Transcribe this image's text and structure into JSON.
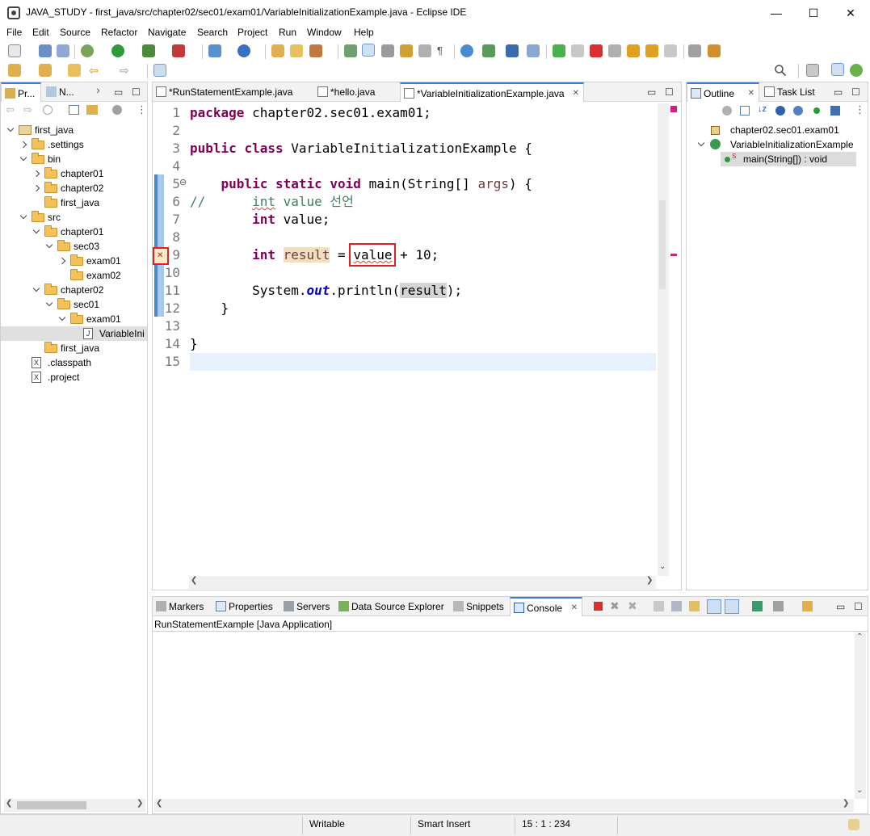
{
  "window": {
    "title": "JAVA_STUDY - first_java/src/chapter02/sec01/exam01/VariableInitializationExample.java - Eclipse IDE",
    "minimize": "—",
    "maximize": "☐",
    "close": "✕"
  },
  "menu": [
    "File",
    "Edit",
    "Source",
    "Refactor",
    "Navigate",
    "Search",
    "Project",
    "Run",
    "Window",
    "Help"
  ],
  "explorer": {
    "tabs": [
      "Pr...",
      "N..."
    ],
    "tree": [
      {
        "label": "first_java",
        "kind": "project",
        "state": "open",
        "level": 0
      },
      {
        "label": ".settings",
        "kind": "folder",
        "state": "closed",
        "level": 1
      },
      {
        "label": "bin",
        "kind": "folder",
        "state": "open",
        "level": 1
      },
      {
        "label": "chapter01",
        "kind": "folder",
        "state": "closed",
        "level": 2
      },
      {
        "label": "chapter02",
        "kind": "folder",
        "state": "closed",
        "level": 2
      },
      {
        "label": "first_java",
        "kind": "folder",
        "state": "none",
        "level": 2
      },
      {
        "label": "src",
        "kind": "folder",
        "state": "open",
        "level": 1
      },
      {
        "label": "chapter01",
        "kind": "folder",
        "state": "open",
        "level": 2
      },
      {
        "label": "sec03",
        "kind": "folder",
        "state": "open",
        "level": 3
      },
      {
        "label": "exam01",
        "kind": "folder",
        "state": "closed",
        "level": 4
      },
      {
        "label": "exam02",
        "kind": "folder",
        "state": "none",
        "level": 4
      },
      {
        "label": "chapter02",
        "kind": "folder",
        "state": "open",
        "level": 2
      },
      {
        "label": "sec01",
        "kind": "folder",
        "state": "open",
        "level": 3
      },
      {
        "label": "exam01",
        "kind": "folder",
        "state": "open",
        "level": 4
      },
      {
        "label": "VariableIni",
        "kind": "java",
        "state": "none",
        "level": 5,
        "selected": true
      },
      {
        "label": "first_java",
        "kind": "folder",
        "state": "none",
        "level": 2
      },
      {
        "label": ".classpath",
        "kind": "xfile",
        "state": "none",
        "level": 1
      },
      {
        "label": ".project",
        "kind": "xfile",
        "state": "none",
        "level": 1
      }
    ]
  },
  "editor": {
    "tabs": [
      {
        "label": "*RunStatementExample.java",
        "active": false
      },
      {
        "label": "*hello.java",
        "active": false
      },
      {
        "label": "*VariableInitializationExample.java",
        "active": true
      }
    ],
    "line_numbers": [
      "1",
      "2",
      "3",
      "4",
      "5",
      "6",
      "7",
      "8",
      "9",
      "10",
      "11",
      "12",
      "13",
      "14",
      "15"
    ],
    "code": {
      "l1_kw": "package",
      "l1_rest": " chapter02.sec01.exam01;",
      "l3_kw1": "public",
      "l3_kw2": "class",
      "l3_rest": " VariableInitializationExample {",
      "l5_indent": "    ",
      "l5_kw1": "public",
      "l5_kw2": "static",
      "l5_kw3": "void",
      "l5_rest": " main(String[] ",
      "l5_args": "args",
      "l5_end": ") {",
      "l6_comment": "//      ",
      "l6_int": "int",
      "l6_rest": " value 선언",
      "l7_indent": "        ",
      "l7_kw": "int",
      "l7_rest": " value;",
      "l9_indent": "        ",
      "l9_kw": "int",
      "l9_result": "result",
      "l9_eq": " = ",
      "l9_value": "value",
      "l9_rest": " + 10;",
      "l11_indent": "        ",
      "l11_sys": "System.",
      "l11_out": "out",
      "l11_print": ".println(",
      "l11_result": "result",
      "l11_end": ");",
      "l12": "    }",
      "l14": "}"
    },
    "fold_marker": "⊖"
  },
  "outline": {
    "tabs": [
      "Outline",
      "Task List"
    ],
    "items": [
      {
        "label": "chapter02.sec01.exam01",
        "level": 0
      },
      {
        "label": "VariableInitializationExample",
        "level": 0
      },
      {
        "label": "main(String[]) : void",
        "level": 1
      }
    ],
    "static_marker": "S"
  },
  "bottom": {
    "tabs": [
      "Markers",
      "Properties",
      "Servers",
      "Data Source Explorer",
      "Snippets",
      "Console"
    ],
    "console_title": "RunStatementExample [Java Application]"
  },
  "status": {
    "writable": "Writable",
    "insert": "Smart Insert",
    "position": "15 : 1 : 234"
  },
  "colors": {
    "keyword": "#7f0055",
    "comment": "#3f7f5f",
    "highlight_box": "#e02020",
    "active_tab_accent": "#3b7bd6"
  }
}
